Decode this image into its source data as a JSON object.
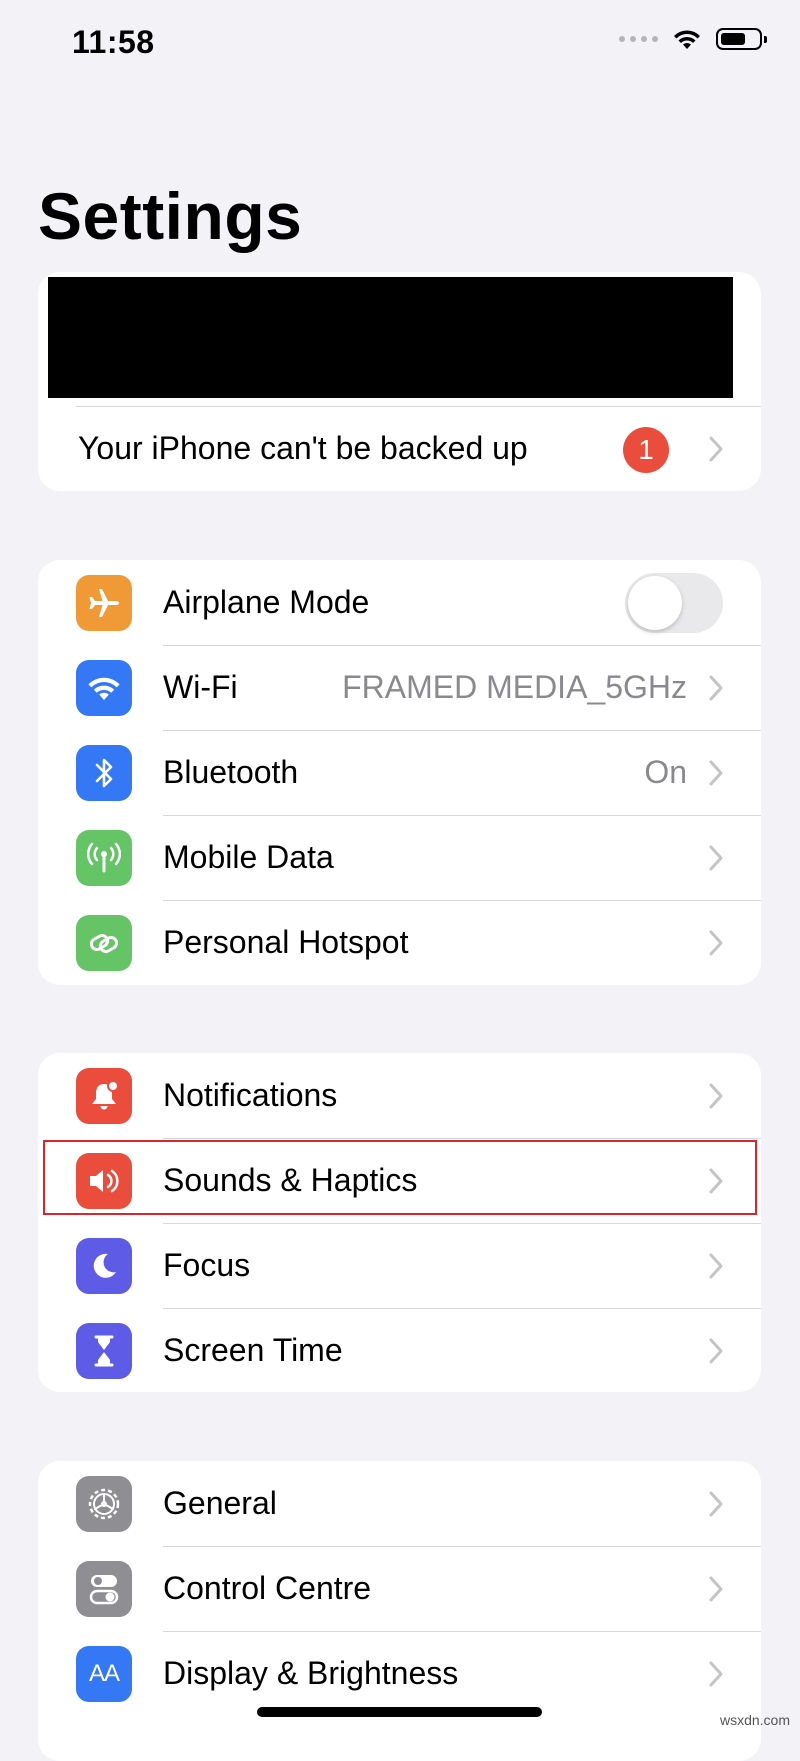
{
  "status_bar": {
    "time": "11:58"
  },
  "title": "Settings",
  "account_group": {
    "backup_label": "Your iPhone can't be backed up",
    "badge_count": "1"
  },
  "connectivity": [
    {
      "label": "Airplane Mode",
      "icon": "airplane-icon",
      "color": "#f09a37",
      "toggle": false
    },
    {
      "label": "Wi-Fi",
      "value": "FRAMED MEDIA_5GHz",
      "icon": "wifi-icon",
      "color": "#3478f6"
    },
    {
      "label": "Bluetooth",
      "value": "On",
      "icon": "bluetooth-icon",
      "color": "#3478f6"
    },
    {
      "label": "Mobile Data",
      "icon": "antenna-icon",
      "color": "#65c466"
    },
    {
      "label": "Personal Hotspot",
      "icon": "hotspot-icon",
      "color": "#65c466"
    }
  ],
  "notifications_group": [
    {
      "label": "Notifications",
      "icon": "bell-icon",
      "color": "#eb4d3d"
    },
    {
      "label": "Sounds & Haptics",
      "icon": "speaker-icon",
      "color": "#eb4d3d",
      "highlighted": true
    },
    {
      "label": "Focus",
      "icon": "moon-icon",
      "color": "#5e5ce6"
    },
    {
      "label": "Screen Time",
      "icon": "hourglass-icon",
      "color": "#5e5ce6"
    }
  ],
  "general_group": [
    {
      "label": "General",
      "icon": "gear-icon",
      "color": "#8e8e93"
    },
    {
      "label": "Control Centre",
      "icon": "switches-icon",
      "color": "#8e8e93"
    },
    {
      "label": "Display & Brightness",
      "icon": "text-size-icon",
      "color": "#3478f6",
      "icon_text": "AA"
    }
  ],
  "watermark": "wsxdn.com"
}
